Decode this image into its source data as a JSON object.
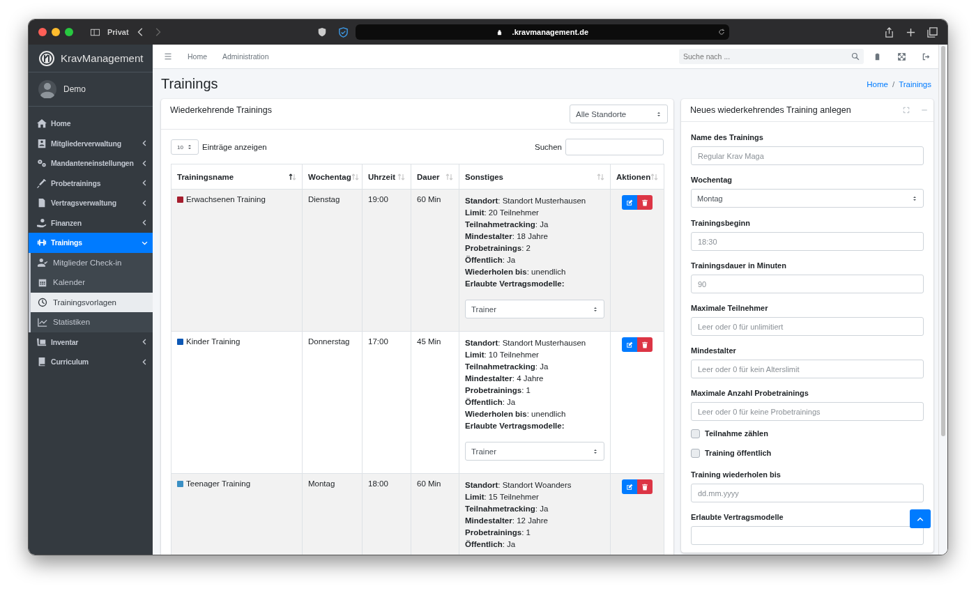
{
  "browser": {
    "profile": "Privat",
    "url": ".kravmanagement.de"
  },
  "sidebar": {
    "brand": "KravManagement",
    "user": "Demo",
    "items": [
      {
        "label": "Home",
        "selected": false
      },
      {
        "label": "Mitgliederverwaltung",
        "selected": false,
        "expanded": false
      },
      {
        "label": "Mandanteneinstellungen",
        "selected": false,
        "expanded": false
      },
      {
        "label": "Probetrainings",
        "selected": false,
        "expanded": false
      },
      {
        "label": "Vertragsverwaltung",
        "selected": false,
        "expanded": false
      },
      {
        "label": "Finanzen",
        "selected": false,
        "expanded": false
      },
      {
        "label": "Trainings",
        "selected": true,
        "expanded": true,
        "children": [
          {
            "label": "Mitglieder Check-in",
            "selected": false
          },
          {
            "label": "Kalender",
            "selected": false
          },
          {
            "label": "Trainingsvorlagen",
            "selected": true
          },
          {
            "label": "Statistiken",
            "selected": false
          }
        ]
      },
      {
        "label": "Inventar",
        "selected": false,
        "expanded": false
      },
      {
        "label": "Curriculum",
        "selected": false,
        "expanded": false
      }
    ]
  },
  "navbar": {
    "links": [
      "Home",
      "Administration"
    ],
    "search": {
      "placeholder": "Suche nach ..."
    }
  },
  "page": {
    "title": "Trainings",
    "breadcrumb": [
      "Home",
      "Trainings"
    ],
    "separator": "/"
  },
  "list_card": {
    "title": "Wiederkehrende Trainings",
    "location_select": "Alle Standorte",
    "page_size": "10",
    "page_size_label": "Einträge anzeigen",
    "search_label": "Suchen",
    "columns": [
      {
        "label": "Trainingsname",
        "sorted": true
      },
      {
        "label": "Wochentag",
        "sorted": false
      },
      {
        "label": "Uhrzeit",
        "sorted": false
      },
      {
        "label": "Dauer",
        "sorted": false
      },
      {
        "label": "Sonstiges",
        "sorted": false
      },
      {
        "label": "Aktionen",
        "sorted": false
      }
    ],
    "rows": [
      {
        "name": "Erwachsenen Training",
        "color": "#a51d2d",
        "weekday": "Dienstag",
        "time": "19:00",
        "duration": "60 Min",
        "details": [
          "**Standort**: Standort Musterhausen",
          "**Limit**: 20 Teilnehmer",
          "**Teilnahmetracking**: Ja",
          "**Mindestalter**: 18 Jahre",
          "**Probetrainings**: 2",
          "**Öffentlich**: Ja",
          "**Wiederholen bis**: unendlich",
          "**Erlaubte Vertragsmodelle:**"
        ],
        "contracts": "Trainer"
      },
      {
        "name": "Kinder Training",
        "color": "#0d58b5",
        "weekday": "Donnerstag",
        "time": "17:00",
        "duration": "45 Min",
        "details": [
          "**Standort**: Standort Musterhausen",
          "**Limit**: 10 Teilnehmer",
          "**Teilnahmetracking**: Ja",
          "**Mindestalter**: 4 Jahre",
          "**Probetrainings**: 1",
          "**Öffentlich**: Ja",
          "**Wiederholen bis**: unendlich",
          "**Erlaubte Vertragsmodelle:**"
        ],
        "contracts": "Trainer"
      },
      {
        "name": "Teenager Training",
        "color": "#3a8fc4",
        "weekday": "Montag",
        "time": "18:00",
        "duration": "60 Min",
        "details": [
          "**Standort**: Standort Woanders",
          "**Limit**: 15 Teilnehmer",
          "**Teilnahmetracking**: Ja",
          "**Mindestalter**: 12 Jahre",
          "**Probetrainings**: 1",
          "**Öffentlich**: Ja"
        ]
      }
    ]
  },
  "form_card": {
    "title": "Neues wiederkehrendes Training anlegen",
    "fields": [
      {
        "kind": "text",
        "label": "Name des Trainings",
        "placeholder": "Regular Krav Maga"
      },
      {
        "kind": "select",
        "label": "Wochentag",
        "value": "Montag"
      },
      {
        "kind": "text",
        "label": "Trainingsbeginn",
        "placeholder": "18:30"
      },
      {
        "kind": "text",
        "label": "Trainingsdauer in Minuten",
        "placeholder": "90"
      },
      {
        "kind": "text",
        "label": "Maximale Teilnehmer",
        "placeholder": "Leer oder 0 für unlimitiert"
      },
      {
        "kind": "text",
        "label": "Mindestalter",
        "placeholder": "Leer oder 0 für kein Alterslimit"
      },
      {
        "kind": "text",
        "label": "Maximale Anzahl Probetrainings",
        "placeholder": "Leer oder 0 für keine Probetrainings"
      },
      {
        "kind": "checkbox",
        "label": "Teilnahme zählen",
        "checked": false
      },
      {
        "kind": "checkbox",
        "label": "Training öffentlich",
        "checked": false
      },
      {
        "kind": "text",
        "label": "Training wiederholen bis",
        "placeholder": "dd.mm.yyyy"
      },
      {
        "kind": "text",
        "label": "Erlaubte Vertragsmodelle"
      }
    ]
  }
}
